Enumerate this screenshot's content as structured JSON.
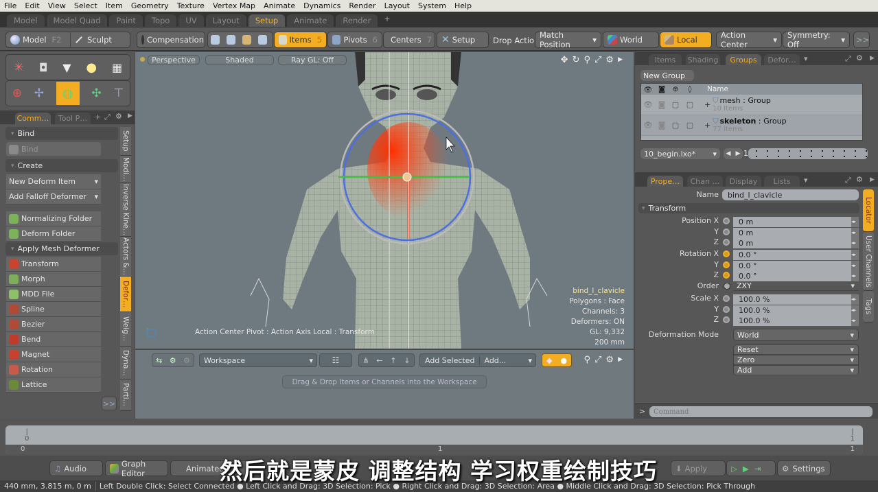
{
  "menu": [
    "File",
    "Edit",
    "View",
    "Select",
    "Item",
    "Geometry",
    "Texture",
    "Vertex Map",
    "Animate",
    "Dynamics",
    "Render",
    "Layout",
    "System",
    "Help"
  ],
  "layout_tabs": [
    {
      "label": "Model"
    },
    {
      "label": "Model Quad"
    },
    {
      "label": "Paint"
    },
    {
      "label": "Topo"
    },
    {
      "label": "UV"
    },
    {
      "label": "Layout"
    },
    {
      "label": "Setup",
      "active": true
    },
    {
      "label": "Animate"
    },
    {
      "label": "Render"
    }
  ],
  "add_tab": "+",
  "toolbar": {
    "model": "Model",
    "model_key": "F2",
    "sculpt": "Sculpt",
    "compensation": "Compensation",
    "items": "Items",
    "items_key": "5",
    "pivots": "Pivots",
    "pivots_key": "6",
    "centers": "Centers",
    "centers_key": "7",
    "setup": "Setup",
    "drop_action": "Drop Action",
    "match_position": "Match Position",
    "world": "World",
    "local": "Local",
    "action_center": "Action Center",
    "symmetry": "Symmetry: Off",
    "more": ">>"
  },
  "left_panel": {
    "tabs": [
      "Comm…",
      "Tool P…"
    ],
    "sections": {
      "bind": "Bind",
      "create": "Create",
      "apply": "Apply Mesh Deformer"
    },
    "bind_button": "Bind",
    "create_dropdowns": [
      "New Deform Item",
      "Add Falloff Deformer"
    ],
    "folders": [
      "Normalizing Folder",
      "Deform Folder"
    ],
    "deformers": [
      {
        "label": "Transform",
        "color": "#c9442c"
      },
      {
        "label": "Morph",
        "color": "#7fae5a"
      },
      {
        "label": "MDD File",
        "color": "#8fbf68"
      },
      {
        "label": "Spline",
        "color": "#b04a36"
      },
      {
        "label": "Bezier",
        "color": "#b04a36"
      },
      {
        "label": "Bend",
        "color": "#c43a2a"
      },
      {
        "label": "Magnet",
        "color": "#c8402f"
      },
      {
        "label": "Rotation",
        "color": "#c85a4a"
      },
      {
        "label": "Lattice",
        "color": "#6a8a3a"
      }
    ],
    "more": ">>",
    "vertical_tabs": [
      {
        "label": "Setup"
      },
      {
        "label": "Modi…"
      },
      {
        "label": "Inverse Kine…"
      },
      {
        "label": "Actors &…"
      },
      {
        "label": "Defor…",
        "active": true
      },
      {
        "label": "Weig…"
      },
      {
        "label": "Dyna…"
      },
      {
        "label": "Parti…"
      }
    ]
  },
  "viewport": {
    "view": "Perspective",
    "shading": "Shaded",
    "raygl": "Ray GL: Off",
    "info": {
      "item": "bind_l_clavicle",
      "polygons": "Polygons : Face",
      "channels": "Channels: 3",
      "deformers": "Deformers: ON",
      "gl": "GL: 9,332",
      "scale": "200 mm"
    },
    "action_center": "Action Center Pivot : Action Axis Local : Transform"
  },
  "workspace": {
    "dropdown": "Workspace",
    "add_selected": "Add Selected",
    "add": "Add...",
    "hint": "Drag & Drop Items or Channels into the Workspace"
  },
  "groups_panel": {
    "tabs": [
      {
        "label": "Items"
      },
      {
        "label": "Shading"
      },
      {
        "label": "Groups",
        "active": true
      },
      {
        "label": "Defor…"
      }
    ],
    "new_group": "New Group",
    "name_header": "Name",
    "rows": [
      {
        "name": "mesh",
        "type": " : Group",
        "count": "10 Items"
      },
      {
        "name": "skeleton",
        "type": " : Group",
        "count": "77 Items"
      }
    ],
    "file": "10_begin.lxo*",
    "frame": "1"
  },
  "properties": {
    "tabs": [
      {
        "label": "Prope…",
        "active": true
      },
      {
        "label": "Chan …"
      },
      {
        "label": "Display"
      },
      {
        "label": "Lists"
      }
    ],
    "name_label": "Name",
    "name_value": "bind_l_clavicle",
    "section": "Transform",
    "rows": [
      {
        "label": "Position X",
        "value": "0 m"
      },
      {
        "label": "Y",
        "value": "0 m"
      },
      {
        "label": "Z",
        "value": "0 m"
      },
      {
        "label": "Rotation X",
        "value": "0.0 °"
      },
      {
        "label": "Y",
        "value": "0.0 °"
      },
      {
        "label": "Z",
        "value": "0.0 °"
      }
    ],
    "order_label": "Order",
    "order_value": "ZXY",
    "scale": [
      {
        "label": "Scale X",
        "value": "100.0 %"
      },
      {
        "label": "Y",
        "value": "100.0 %"
      },
      {
        "label": "Z",
        "value": "100.0 %"
      }
    ],
    "deformation_label": "Deformation Mode",
    "deformation_value": "World",
    "actions": [
      "Reset",
      "Zero",
      "Add"
    ],
    "side_tabs": [
      {
        "label": "Locator",
        "active": true
      },
      {
        "label": "User Channels"
      },
      {
        "label": "Tags"
      }
    ],
    "command_placeholder": "Command"
  },
  "timeline": {
    "start": "0",
    "end": "1",
    "ruler_start": "0",
    "ruler_end": "1"
  },
  "bottom": {
    "audio": "Audio",
    "graph_editor": "Graph Editor",
    "animated": "Animated",
    "apply": "Apply",
    "settings": "Settings"
  },
  "status": {
    "coords": "440 mm, 3.815 m, 0 m",
    "hint": "Left Double Click: Select Connected ● Left Click and Drag: 3D Selection: Pick ● Right Click and Drag: 3D Selection: Area ● Middle Click and Drag: 3D Selection: Pick Through"
  },
  "subtitle": "然后就是蒙皮 调整结构 学习权重绘制技巧"
}
